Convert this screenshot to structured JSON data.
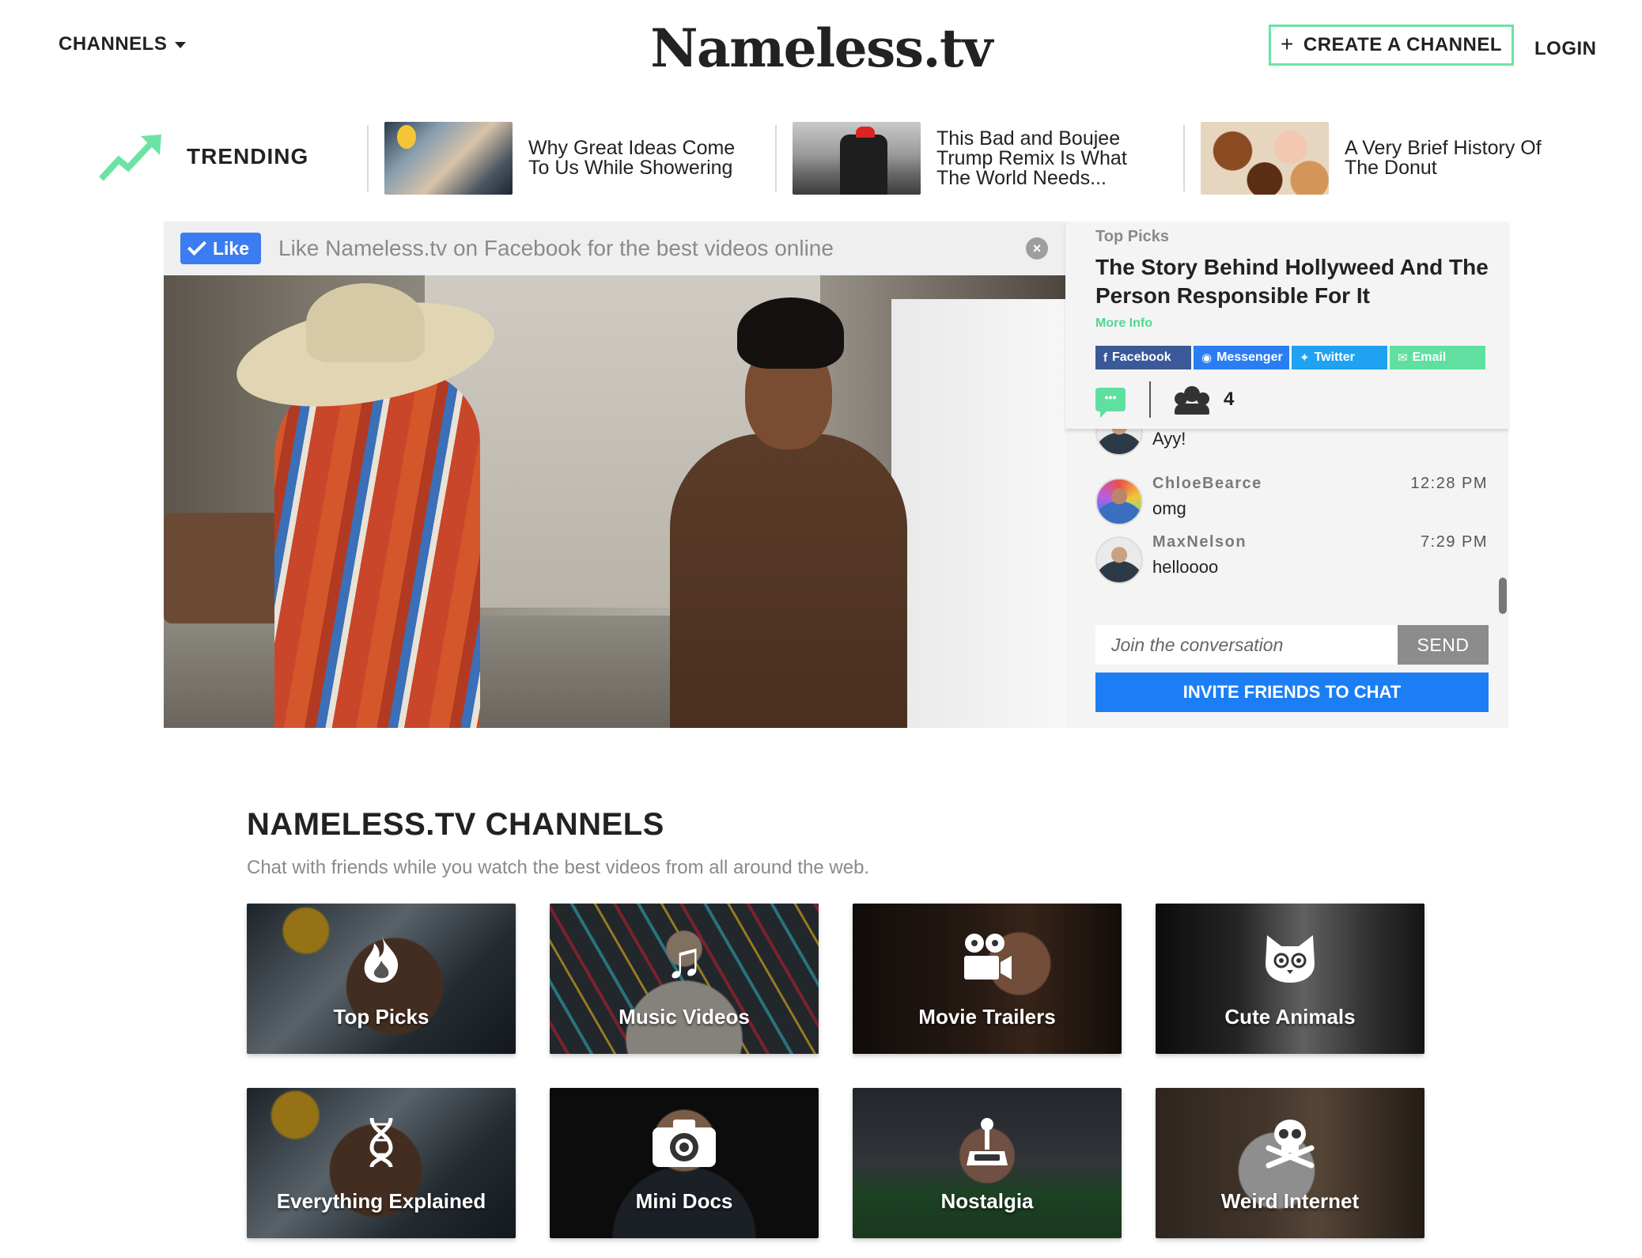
{
  "header": {
    "channels_menu": "CHANNELS",
    "logo": "Nameless.tv",
    "create_channel": "CREATE A CHANNEL",
    "create_channel_icon": "plus-icon",
    "login": "LOGIN"
  },
  "trending": {
    "label": "TRENDING",
    "icon": "trending-up-icon",
    "items": [
      {
        "title": "Why Great Ideas Come To Us While Showering"
      },
      {
        "title": "This Bad and Boujee Trump Remix Is What The World Needs..."
      },
      {
        "title": "A Very Brief History Of The Donut"
      }
    ]
  },
  "facebook_bar": {
    "like": "Like",
    "text": "Like Nameless.tv on Facebook for the best videos online"
  },
  "sidebar": {
    "section": "Top Picks",
    "title": "The Story Behind Hollyweed And The Person Responsible For It",
    "more_info": "More Info",
    "shares": [
      {
        "label": "Facebook",
        "icon": "facebook-icon"
      },
      {
        "label": "Messenger",
        "icon": "messenger-icon"
      },
      {
        "label": "Twitter",
        "icon": "twitter-icon"
      },
      {
        "label": "Email",
        "icon": "email-icon"
      }
    ],
    "viewer_count": "4",
    "messages": [
      {
        "user": "",
        "time": "",
        "text": "Ayy!"
      },
      {
        "user": "ChloeBearce",
        "time": "12:28 PM",
        "text": "omg"
      },
      {
        "user": "MaxNelson",
        "time": "7:29 PM",
        "text": "helloooo"
      }
    ],
    "input_placeholder": "Join the conversation",
    "send": "SEND",
    "invite": "INVITE FRIENDS TO CHAT"
  },
  "channels": {
    "heading": "NAMELESS.TV CHANNELS",
    "subheading": "Chat with friends while you watch the best videos from all around the web.",
    "items": [
      {
        "label": "Top Picks",
        "icon": "fire-icon"
      },
      {
        "label": "Music Videos",
        "icon": "music-note-icon"
      },
      {
        "label": "Movie Trailers",
        "icon": "movie-camera-icon"
      },
      {
        "label": "Cute Animals",
        "icon": "cat-icon"
      },
      {
        "label": "Everything Explained",
        "icon": "dna-icon"
      },
      {
        "label": "Mini Docs",
        "icon": "camera-icon"
      },
      {
        "label": "Nostalgia",
        "icon": "joystick-icon"
      },
      {
        "label": "Weird Internet",
        "icon": "skull-crossbones-icon"
      }
    ]
  },
  "colors": {
    "accent_green": "#6de3a3",
    "like_blue": "#3b7cf0",
    "invite_blue": "#1c7ef5",
    "facebook": "#3b5998",
    "messenger": "#2b7df2",
    "twitter": "#1fa2f2",
    "email": "#5fe0a0"
  }
}
